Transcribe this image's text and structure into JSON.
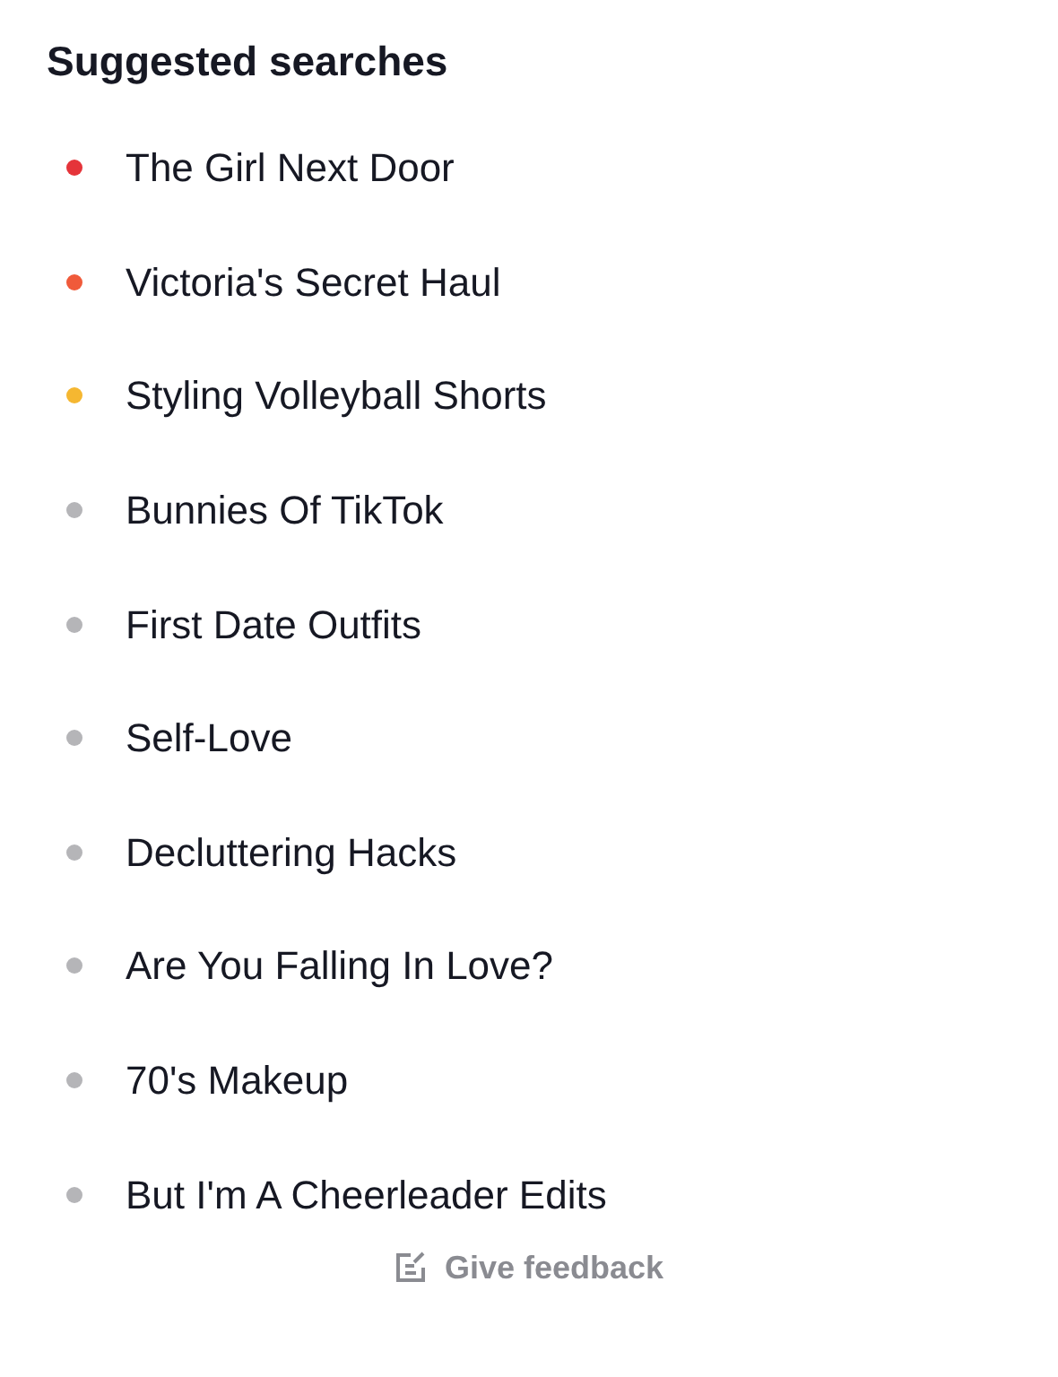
{
  "title": "Suggested searches",
  "items": [
    {
      "label": "The Girl Next Door",
      "color": "#e5343a"
    },
    {
      "label": "Victoria's Secret Haul",
      "color": "#f05a3a"
    },
    {
      "label": "Styling Volleyball Shorts",
      "color": "#f5b731"
    },
    {
      "label": "Bunnies Of TikTok",
      "color": "#b5b5b8"
    },
    {
      "label": "First Date Outfits",
      "color": "#b5b5b8"
    },
    {
      "label": "Self-Love",
      "color": "#b5b5b8"
    },
    {
      "label": "Decluttering Hacks",
      "color": "#b5b5b8"
    },
    {
      "label": "Are You Falling In Love?",
      "color": "#b5b5b8"
    },
    {
      "label": "70's Makeup",
      "color": "#b5b5b8"
    },
    {
      "label": "But I'm A Cheerleader Edits",
      "color": "#b5b5b8"
    }
  ],
  "feedback": "Give feedback"
}
